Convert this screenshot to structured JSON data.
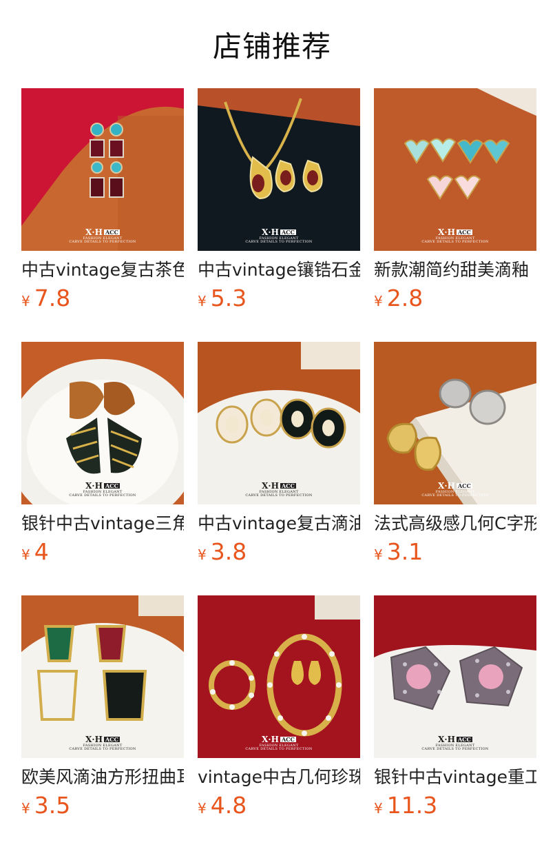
{
  "section_title": "店铺推荐",
  "watermark": {
    "brand": "X·H",
    "badge": "ACC",
    "line1": "FASHION ELEGANT",
    "line2": "CARVE DETAILS TO PERFECTION"
  },
  "currency": "¥",
  "colors": {
    "price": "#e8561d"
  },
  "products": [
    {
      "name": "中古vintage复古茶色",
      "price": "7.8",
      "image": "vintage-crystal-drop-earrings"
    },
    {
      "name": "中古vintage镶锆石金",
      "price": "5.3",
      "image": "gold-teardrop-necklace-set"
    },
    {
      "name": "新款潮简约甜美滴釉",
      "price": "2.8",
      "image": "enamel-heart-hoop-earrings"
    },
    {
      "name": "银针中古vintage三角",
      "price": "4",
      "image": "tiger-stripe-triangle-earrings"
    },
    {
      "name": "中古vintage复古滴油",
      "price": "3.8",
      "image": "enamel-pearl-stud-earrings"
    },
    {
      "name": "法式高级感几何C字形",
      "price": "3.1",
      "image": "textured-c-hoop-earrings"
    },
    {
      "name": "欧美风滴油方形扭曲耳",
      "price": "3.5",
      "image": "enamel-square-drop-earrings"
    },
    {
      "name": "vintage中古几何珍珠",
      "price": "4.8",
      "image": "pearl-flower-jewelry-set"
    },
    {
      "name": "银针中古vintage重工",
      "price": "11.3",
      "image": "rhinestone-flower-earrings"
    }
  ]
}
